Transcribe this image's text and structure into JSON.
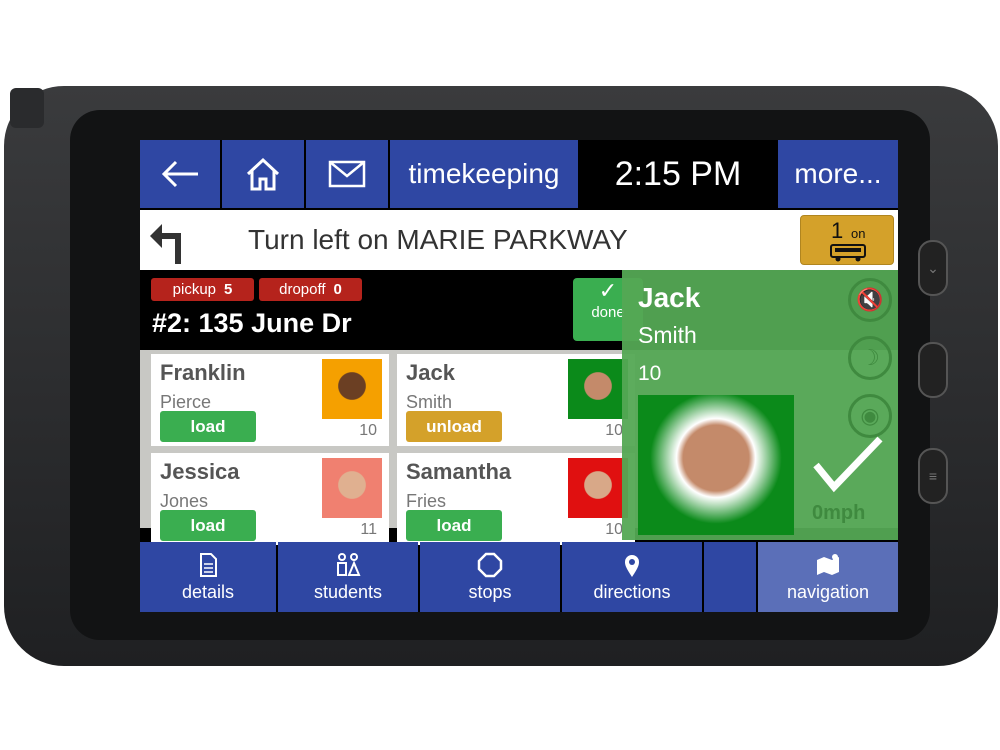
{
  "topbar": {
    "timekeeping": "timekeeping",
    "time": "2:15 PM",
    "more": "more..."
  },
  "direction": {
    "text": "Turn left on MARIE PARKWAY",
    "onboard_count": "1",
    "onboard_label": "on"
  },
  "stop": {
    "pickup_label": "pickup",
    "pickup_count": "5",
    "dropoff_label": "dropoff",
    "dropoff_count": "0",
    "title": "#2: 135 June Dr",
    "done_label": "done"
  },
  "students": [
    {
      "first": "Franklin",
      "last": "Pierce",
      "action": "load",
      "grade": "10",
      "photo_bg": "#f5a000"
    },
    {
      "first": "Jack",
      "last": "Smith",
      "action": "unload",
      "grade": "10",
      "photo_bg": "#0b8a1a"
    },
    {
      "first": "Jessica",
      "last": "Jones",
      "action": "load",
      "grade": "11",
      "photo_bg": "#f08070"
    },
    {
      "first": "Samantha",
      "last": "Fries",
      "action": "load",
      "grade": "10",
      "photo_bg": "#e01010"
    }
  ],
  "selected": {
    "first": "Jack",
    "last": "Smith",
    "grade": "10",
    "speed": "0mph"
  },
  "bottom_nav": [
    {
      "label": "details"
    },
    {
      "label": "students"
    },
    {
      "label": "stops"
    },
    {
      "label": "directions"
    },
    {
      "label": "navigation"
    }
  ],
  "colors": {
    "primary": "#2f47a3",
    "load": "#3aae50",
    "unload": "#d4a12a",
    "badge": "#b5231c",
    "overlay": "#54a854"
  }
}
